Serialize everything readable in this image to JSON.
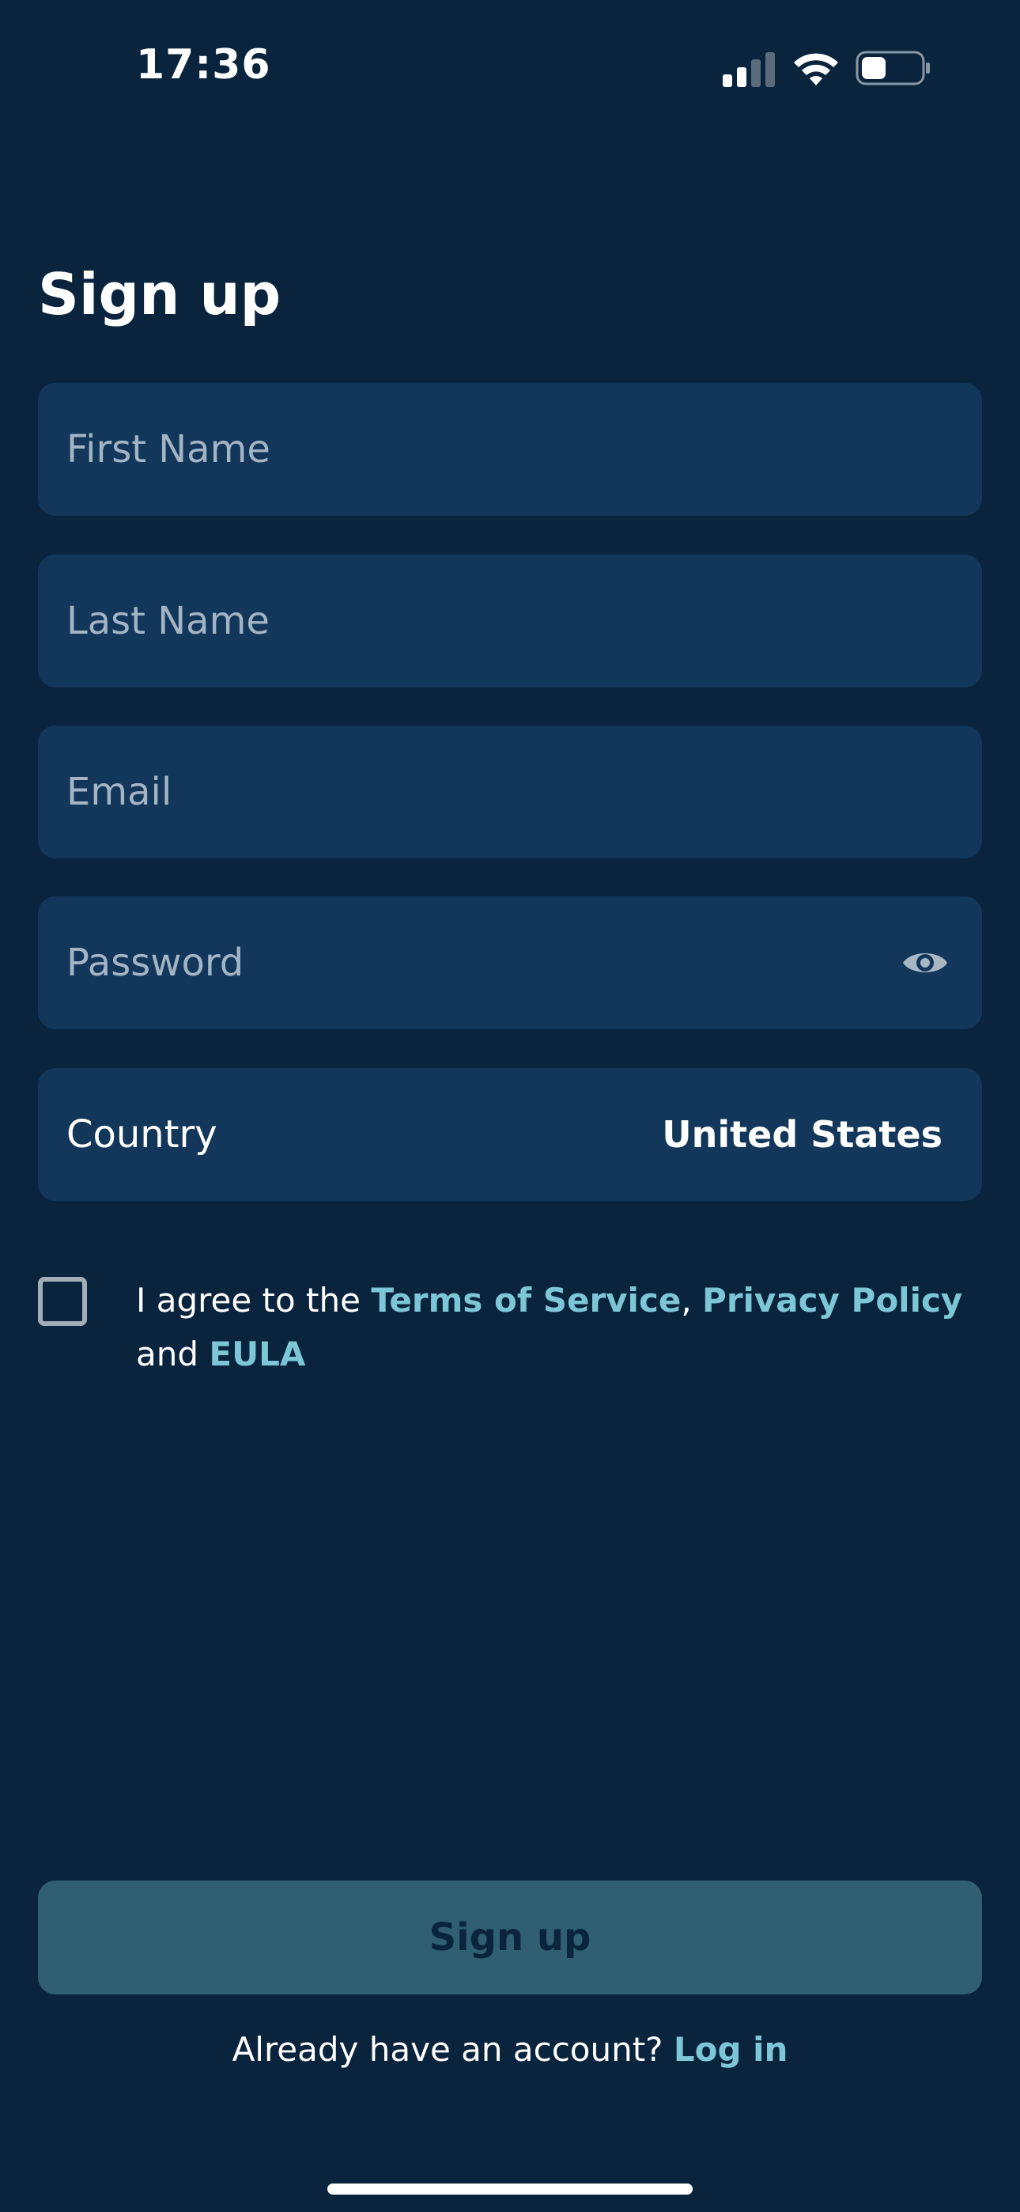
{
  "status_bar": {
    "time": "17:36",
    "icons": [
      "signal-icon",
      "wifi-icon",
      "battery-icon"
    ]
  },
  "page": {
    "title": "Sign up"
  },
  "form": {
    "first_name_placeholder": "First Name",
    "last_name_placeholder": "Last Name",
    "email_placeholder": "Email",
    "password_placeholder": "Password",
    "country_label": "Country",
    "country_value": "United States"
  },
  "agreement": {
    "prefix": "I agree to the ",
    "terms_link": "Terms of Service",
    "separator": ", ",
    "privacy_link": "Privacy Policy",
    "and_text": " and ",
    "eula_link": "EULA"
  },
  "actions": {
    "signup_label": "Sign up",
    "login_prompt": "Already have an account? ",
    "login_link": "Log in"
  },
  "colors": {
    "background": "#0a243d",
    "field": "#12375a",
    "accent_link": "#7cc6d6",
    "button": "#305f71"
  }
}
